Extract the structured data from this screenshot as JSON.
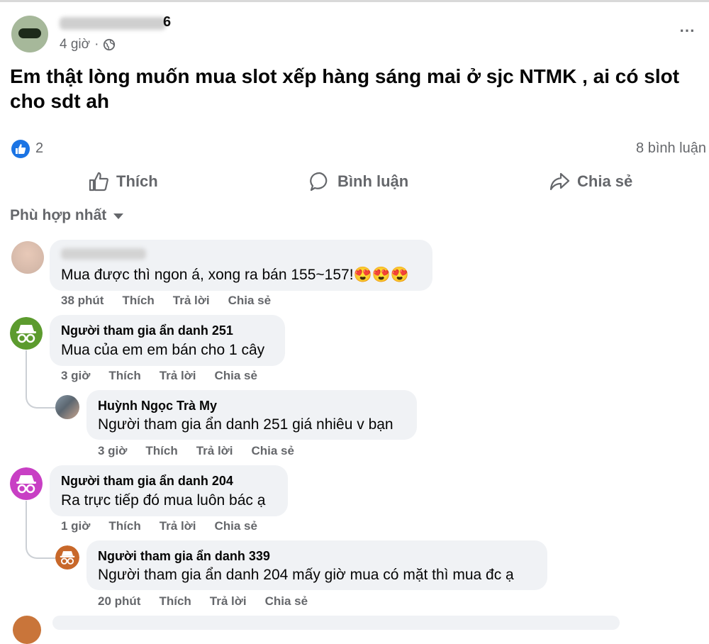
{
  "post": {
    "author_suffix": "6",
    "time": "4 giờ",
    "separator": "·",
    "text": "Em thật lòng muốn mua slot xếp hàng sáng mai ở sjc NTMK , ai có slot cho sdt ah",
    "like_count": "2",
    "comments_count": "8 bình luận",
    "more_icon": "⋯"
  },
  "actions": {
    "like": "Thích",
    "comment": "Bình luận",
    "share": "Chia sẻ"
  },
  "sort_label": "Phù hợp nhất",
  "comments": [
    {
      "text": "Mua được thì ngon á, xong ra bán 155~157!😍😍😍",
      "time": "38 phút",
      "like": "Thích",
      "reply": "Trả lời",
      "share": "Chia sẻ"
    },
    {
      "name": "Người tham gia ẩn danh 251",
      "text": "Mua của em em bán cho 1 cây",
      "time": "3 giờ",
      "like": "Thích",
      "reply": "Trả lời",
      "share": "Chia sẻ",
      "avatar_color": "#5c9b2e"
    },
    {
      "name": "Huỳnh Ngọc Trà My",
      "text": "Người tham gia ẩn danh 251 giá nhiêu v bạn",
      "time": "3 giờ",
      "like": "Thích",
      "reply": "Trả lời",
      "share": "Chia sẻ"
    },
    {
      "name": "Người tham gia ẩn danh 204",
      "text": "Ra trực tiếp đó mua luôn bác ạ",
      "time": "1 giờ",
      "like": "Thích",
      "reply": "Trả lời",
      "share": "Chia sẻ",
      "avatar_color": "#c83fc4"
    },
    {
      "name": "Người tham gia ẩn danh 339",
      "text": "Người tham gia ẩn danh 204 mấy giờ mua có mặt thì mua đc ạ",
      "time": "20 phút",
      "like": "Thích",
      "reply": "Trả lời",
      "share": "Chia sẻ",
      "avatar_color": "#c8682a"
    }
  ],
  "colors": {
    "like_blue": "#1b74e4",
    "bubble": "#f0f2f5",
    "secondary_text": "#65676b"
  }
}
